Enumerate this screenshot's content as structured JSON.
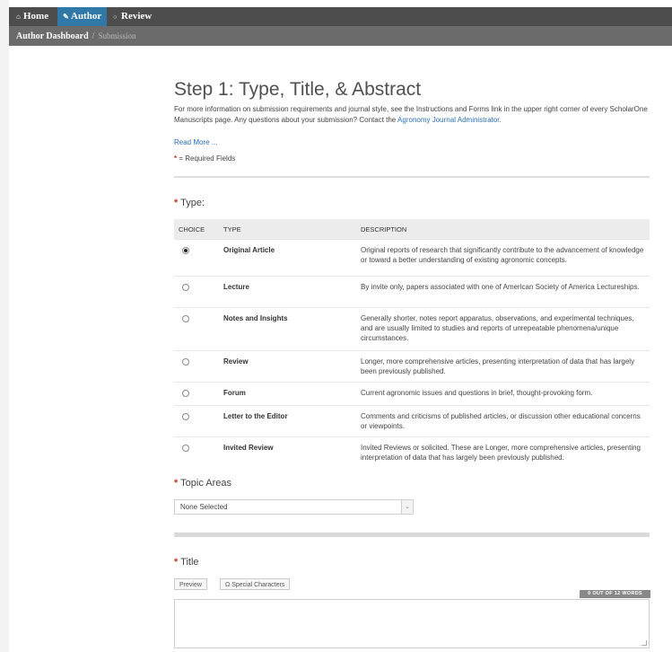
{
  "nav": {
    "home": "Home",
    "author": "Author",
    "review": "Review"
  },
  "breadcrumb": {
    "dashboard": "Author Dashboard",
    "separator": "/",
    "current": "Submission"
  },
  "step": {
    "title": "Step 1: Type, Title, & Abstract",
    "intro_text": "For more information on submission requirements and journal style, see the Instructions and Forms link in the upper right corner of every ScholarOne Manuscripts page. Any questions about your submission? Contact the",
    "intro_link": "Agronomy Journal Administrator",
    "intro_end": ".",
    "read_more": "Read More ...",
    "required_marker": "*",
    "required_text": "= Required Fields"
  },
  "type_section": {
    "label": "Type:",
    "columns": [
      "CHOICE",
      "TYPE",
      "DESCRIPTION"
    ],
    "rows": [
      {
        "type": "Original Article",
        "desc": "Original reports of research that significantly contribute to the advancement of knowledge or toward a better understanding of existing agronomic concepts.",
        "selected": true
      },
      {
        "type": "Lecture",
        "desc": "By invite only, papers associated with one of American Society of America Lectureships.",
        "selected": false
      },
      {
        "type": "Notes and Insights",
        "desc": "Generally shorter, notes report apparatus, observations, and experimental techniques, and are usually limited to studies and reports of unrepeatable phenomena/unique circumstances.",
        "selected": false
      },
      {
        "type": "Review",
        "desc": "Longer, more comprehensive articles, presenting interpretation of data that has largely been previously published.",
        "selected": false
      },
      {
        "type": "Forum",
        "desc": "Current agronomic issues and questions in brief, thought-provoking form.",
        "selected": false
      },
      {
        "type": "Letter to the Editor",
        "desc": "Comments and criticisms of published articles, or discussion other educational concerns or viewpoints.",
        "selected": false
      },
      {
        "type": "Invited Review",
        "desc": "Invited Reviews or solicited. These are Longer, more comprehensive articles, presenting interpretation of data that has largely been previously published.",
        "selected": false
      }
    ]
  },
  "topic": {
    "label": "Topic Areas",
    "selected": "None Selected"
  },
  "title_section": {
    "label": "Title",
    "preview_button": "Preview",
    "special_chars_button": "Special Characters",
    "word_counter": "0 OUT OF 12 WORDS",
    "value": ""
  },
  "icons": {
    "home": "home-icon",
    "author": "pencil-icon",
    "review": "speech-bubble-icon",
    "special": "omega-icon",
    "select_arrow": "chevron-down-icon"
  },
  "colors": {
    "topnav": "#4d4d4d",
    "active_tab": "#2f78a8",
    "subnav": "#6b6b6b",
    "link": "#2a6fb5",
    "required": "#c0392b"
  }
}
